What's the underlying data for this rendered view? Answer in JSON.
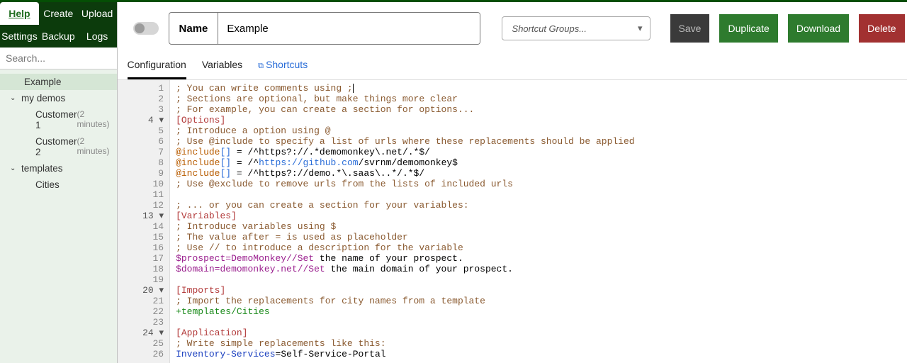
{
  "nav": {
    "help": "Help",
    "create": "Create",
    "upload": "Upload",
    "settings": "Settings",
    "backup": "Backup",
    "logs": "Logs"
  },
  "search": {
    "placeholder": "Search..."
  },
  "tree": {
    "example": "Example",
    "group1": "my demos",
    "child1": "Customer 1",
    "child1_meta": "(2 minutes)",
    "child2": "Customer 2",
    "child2_meta": "(2 minutes)",
    "group2": "templates",
    "child3": "Cities"
  },
  "header": {
    "name_label": "Name",
    "name_value": "Example",
    "dropdown": "Shortcut Groups...",
    "save": "Save",
    "duplicate": "Duplicate",
    "download": "Download",
    "delete": "Delete"
  },
  "tabs": {
    "config": "Configuration",
    "vars": "Variables",
    "short": "Shortcuts"
  },
  "code": {
    "l1": "; You can write comments using ;",
    "l2": "; Sections are optional, but make things more clear",
    "l3": "; For example, you can create a section for options...",
    "l4": "[Options]",
    "l5": "; Introduce a option using @",
    "l6": "; Use @include to specify a list of urls where these replacements should be applied",
    "l7a": "@include",
    "l7b": "[]",
    "l7c": " = /^https?://.*demomonkey\\.net/.*$/",
    "l8a": "@include",
    "l8b": "[]",
    "l8c": " = /^",
    "l8d": "https://github.com",
    "l8e": "/svrnm/demomonkey$",
    "l9a": "@include",
    "l9b": "[]",
    "l9c": " = /^https?://demo.*\\.saas\\..*/.*$/",
    "l10": "; Use @exclude to remove urls from the lists of included urls",
    "l12": "; ... or you can create a section for your variables:",
    "l13": "[Variables]",
    "l14": "; Introduce variables using $",
    "l15": "; The value after = is used as placeholder",
    "l16": "; Use // to introduce a description for the variable",
    "l17a": "$prospect=DemoMonkey//Set",
    "l17b": " the name of your prospect.",
    "l18a": "$domain=demomonkey.net//Set",
    "l18b": " the main domain of your prospect.",
    "l20": "[Imports]",
    "l21": "; Import the replacements for city names from a template",
    "l22": "+templates/Cities",
    "l24": "[Application]",
    "l25": "; Write simple replacements like this:",
    "l26a": "Inventory-Services",
    "l26b": "=Self-Service-Portal"
  }
}
